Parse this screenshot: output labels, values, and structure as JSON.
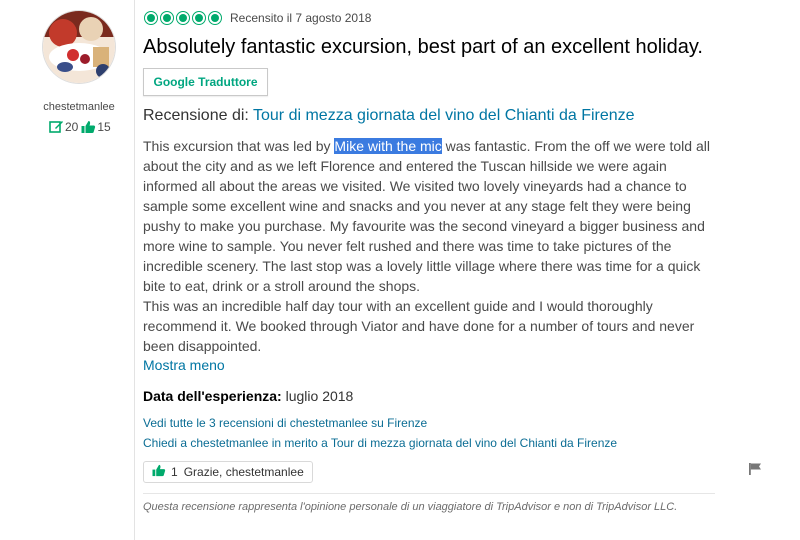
{
  "reviewer": {
    "username": "chestetmanlee",
    "contributions": "20",
    "helpful_votes": "15"
  },
  "review": {
    "rating": 5,
    "date_text": "Recensito il 7 agosto 2018",
    "title": "Absolutely fantastic excursion, best part of an excellent holiday.",
    "translate_button": "Google Traduttore",
    "review_of_label": "Recensione di:",
    "review_of_link": "Tour di mezza giornata del vino del Chianti da Firenze",
    "body_part1": "This excursion that was led by ",
    "body_highlight": "Mike with the mic",
    "body_part2": " was fantastic. From the off we were told all about the city and as we left Florence and entered the Tuscan hillside we were again informed all about the areas we visited. We visited two lovely vineyards had a chance to sample some excellent wine and snacks and you never at any stage felt they were being pushy to make you purchase. My favourite was the second vineyard a bigger business and more wine to sample. You never felt rushed and there was time to take pictures of the incredible scenery. The last stop was a lovely little village where there was time for a quick bite to eat, drink or a stroll around the shops.",
    "body_paragraph2": "This was an incredible half day tour with an excellent guide and I would thoroughly recommend it. We booked through Viator and have done for a number of tours and never been disappointed.",
    "show_less": "Mostra meno",
    "experience_label": "Data dell'esperienza:",
    "experience_value": "luglio 2018",
    "link_all_reviews": "Vedi tutte le 3 recensioni di chestetmanlee su Firenze",
    "link_ask": "Chiedi a chestetmanlee in merito a Tour di mezza giornata del vino del Chianti da Firenze",
    "thanks_count": "1",
    "thanks_label": "Grazie, chestetmanlee",
    "disclaimer": "Questa recensione rappresenta l'opinione personale di un viaggiatore di TripAdvisor e non di TripAdvisor LLC."
  },
  "icons": {
    "rating": "bubble-rating-icon",
    "contributions": "review-edit-icon",
    "helpful": "thumbs-up-icon",
    "flag": "flag-icon"
  },
  "colors": {
    "brand_green": "#00aa6c",
    "link_blue": "#0076a3",
    "highlight": "#3b7be0"
  }
}
